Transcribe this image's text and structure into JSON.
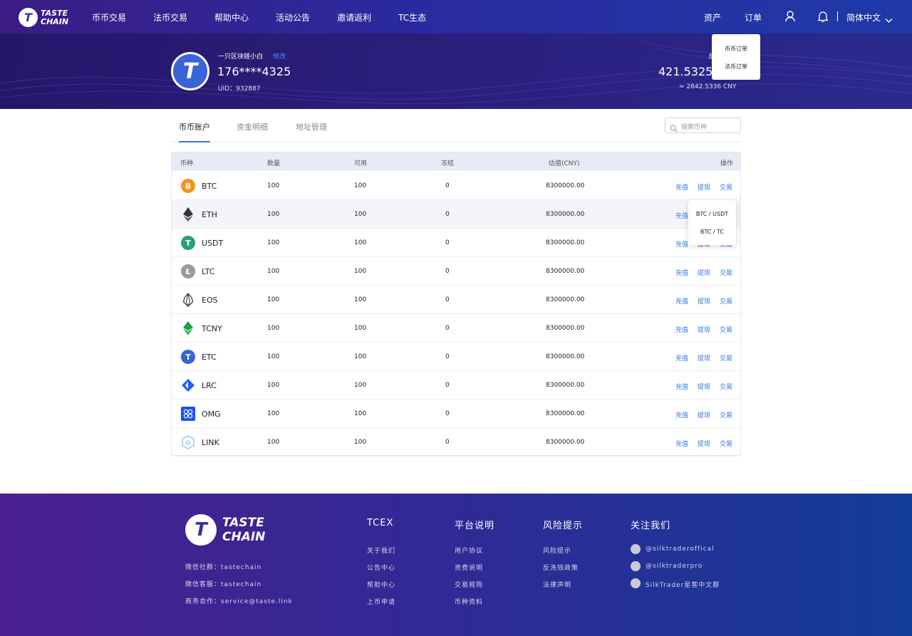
{
  "brand": {
    "line1": "TASTE",
    "line2": "CHAIN",
    "mark": "T"
  },
  "nav": [
    "币币交易",
    "法币交易",
    "帮助中心",
    "活动公告",
    "邀请返利",
    "TC生态"
  ],
  "right_nav": {
    "assets": "资产",
    "orders": "订单",
    "language": "简体中文"
  },
  "orders_menu": [
    "币币订单",
    "法币订单"
  ],
  "profile": {
    "nickname": "一只区块链小白",
    "edit": "修改",
    "phone": "176****4325",
    "uid": "UID：932887"
  },
  "balance": {
    "label": "总",
    "value": "421.5325",
    "cny": "≈ 2842.5336 CNY"
  },
  "tabs": [
    "币币账户",
    "资金明细",
    "地址管理"
  ],
  "search": {
    "placeholder": "搜索币种"
  },
  "table": {
    "headers": [
      "币种",
      "数量",
      "可用",
      "冻结",
      "估值(CNY)",
      "操作"
    ],
    "actions": [
      "充值",
      "提现",
      "交易"
    ],
    "rows": [
      {
        "coin": "BTC",
        "qty": "100",
        "avail": "100",
        "frozen": "0",
        "value": "8300000.00"
      },
      {
        "coin": "ETH",
        "qty": "100",
        "avail": "100",
        "frozen": "0",
        "value": "8300000.00"
      },
      {
        "coin": "USDT",
        "qty": "100",
        "avail": "100",
        "frozen": "0",
        "value": "8300000.00"
      },
      {
        "coin": "LTC",
        "qty": "100",
        "avail": "100",
        "frozen": "0",
        "value": "8300000.00"
      },
      {
        "coin": "EOS",
        "qty": "100",
        "avail": "100",
        "frozen": "0",
        "value": "8300000.00"
      },
      {
        "coin": "TCNY",
        "qty": "100",
        "avail": "100",
        "frozen": "0",
        "value": "8300000.00"
      },
      {
        "coin": "ETC",
        "qty": "100",
        "avail": "100",
        "frozen": "0",
        "value": "8300000.00"
      },
      {
        "coin": "LRC",
        "qty": "100",
        "avail": "100",
        "frozen": "0",
        "value": "8300000.00"
      },
      {
        "coin": "OMG",
        "qty": "100",
        "avail": "100",
        "frozen": "0",
        "value": "8300000.00"
      },
      {
        "coin": "LINK",
        "qty": "100",
        "avail": "100",
        "frozen": "0",
        "value": "8300000.00"
      }
    ]
  },
  "trade_menu": [
    "BTC / USDT",
    "BTC / TC"
  ],
  "footer": {
    "contacts": [
      "微信社群：tastechain",
      "微信客服：tastechain",
      "商务合作：service@taste.link"
    ],
    "columns": [
      {
        "title": "TCEX",
        "links": [
          "关于我们",
          "公告中心",
          "帮助中心",
          "上币申请"
        ]
      },
      {
        "title": "平台说明",
        "links": [
          "用户协议",
          "资费说明",
          "交易规则",
          "币种资料"
        ]
      },
      {
        "title": "风险提示",
        "links": [
          "风险提示",
          "反洗钱政策",
          "法律声明"
        ]
      },
      {
        "title": "关注我们",
        "links": [
          "@silktraderoffical",
          "@silktraderpro",
          "SilkTrader星客中文群"
        ]
      }
    ]
  },
  "colors": {
    "accent": "#2f74e6",
    "header": "#2a2aa0"
  }
}
